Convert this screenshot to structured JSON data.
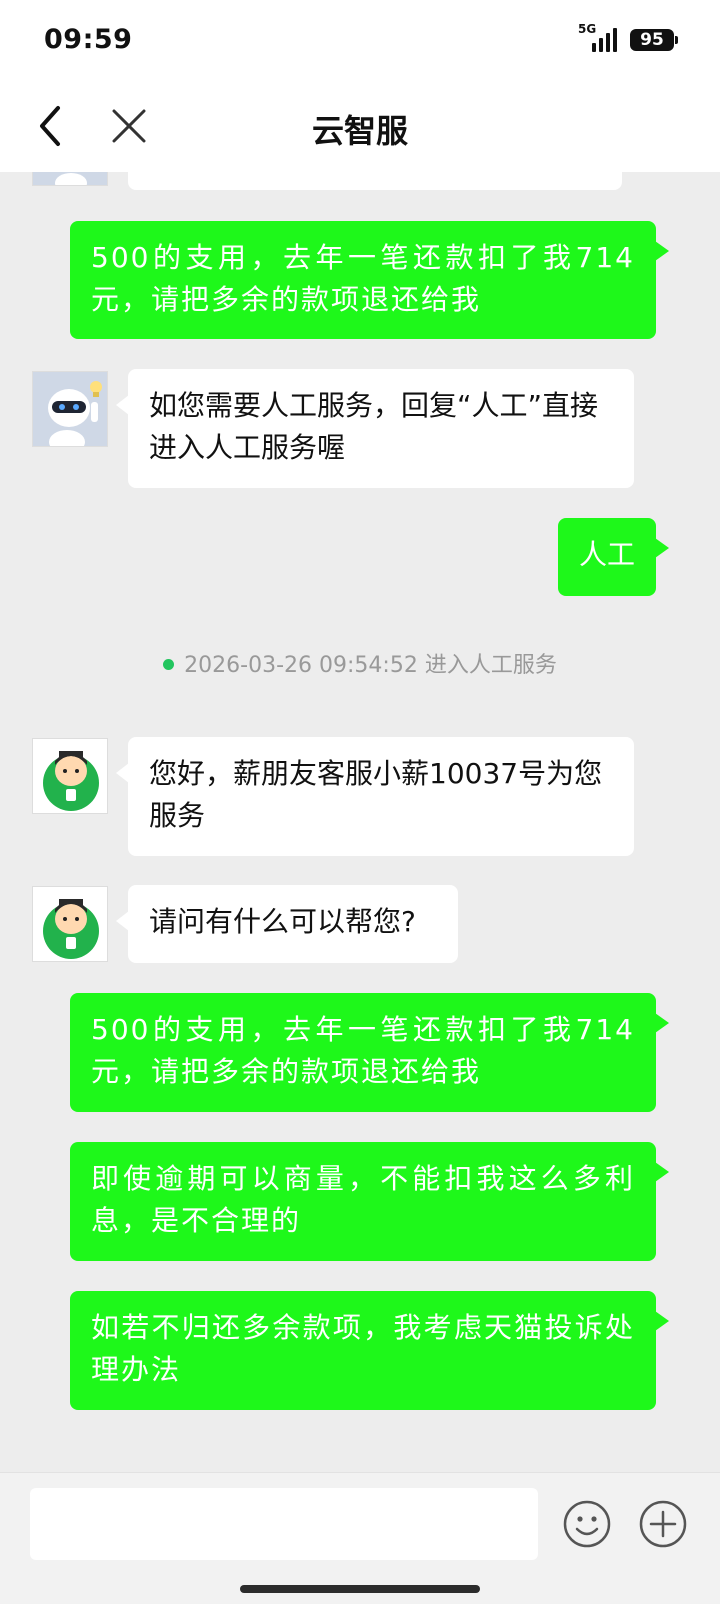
{
  "status_bar": {
    "time": "09:59",
    "network": "5G",
    "battery": "95"
  },
  "nav": {
    "title": "云智服",
    "back_icon": "chevron-left-icon",
    "close_icon": "close-icon"
  },
  "messages": {
    "m1": {
      "side": "right",
      "text": "500的支用，去年一笔还款扣了我714元，请把多余的款项退还给我"
    },
    "m2": {
      "side": "left",
      "sender": "bot",
      "text": "如您需要人工服务，回复“人工”直接进入人工服务喔"
    },
    "m3": {
      "side": "right",
      "text": "人工"
    },
    "system": {
      "timestamp": "2026-03-26 09:54:52",
      "text": "进入人工服务"
    },
    "m4": {
      "side": "left",
      "sender": "agent",
      "text": "您好，薪朋友客服小薪10037号为您服务"
    },
    "m5": {
      "side": "left",
      "sender": "agent",
      "text": "请问有什么可以帮您?"
    },
    "m6": {
      "side": "right",
      "text": "500的支用，去年一笔还款扣了我714元，请把多余的款项退还给我"
    },
    "m7": {
      "side": "right",
      "text": "即使逾期可以商量，不能扣我这么多利息，是不合理的"
    },
    "m8": {
      "side": "right",
      "text": "如若不归还多余款项，我考虑天猫投诉处理办法"
    }
  },
  "input": {
    "value": "",
    "placeholder": "",
    "emoji_icon": "smiley-icon",
    "plus_icon": "plus-circle-icon"
  },
  "colors": {
    "user_bubble": "#1ef81a",
    "background": "#ededed",
    "agent_avatar": "#22b24c"
  }
}
